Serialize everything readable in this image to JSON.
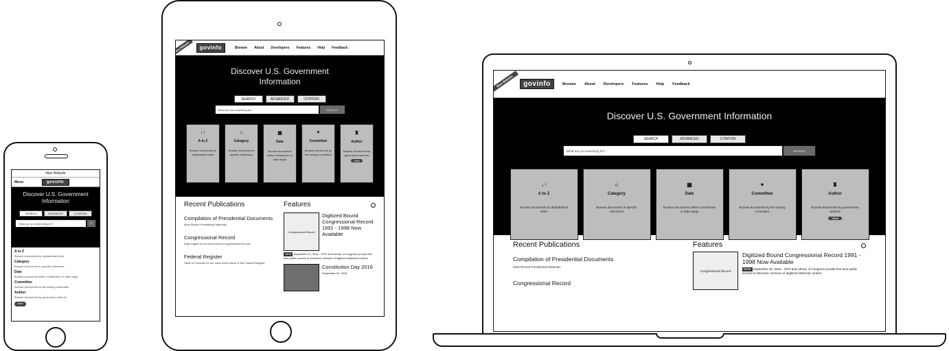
{
  "site": {
    "logo": "govinfo",
    "ribbon": "New Website",
    "nav": [
      "Browse",
      "About",
      "Developers",
      "Features",
      "Help",
      "Feedback"
    ],
    "menu_label": "Menu",
    "hero_title_line1": "Discover U.S. Government",
    "hero_title_line2": "Information",
    "hero_title_full": "Discover U.S. Government Information",
    "tabs": [
      "SEARCH",
      "ADVANCED",
      "CITATION"
    ],
    "search_placeholder": "What are you searching for?",
    "search_button": "SEARCH",
    "cards": [
      {
        "icon": "↓↑",
        "icon_name": "sort-az-icon",
        "title": "A to Z",
        "desc": "Browse documents by alphabetical order"
      },
      {
        "icon": "⌂",
        "icon_name": "category-icon",
        "title": "Category",
        "desc": "Browse documents in specific collections"
      },
      {
        "icon": "▦",
        "icon_name": "calendar-icon",
        "title": "Date",
        "desc": "Browse documents within a timeframe or date range"
      },
      {
        "icon": "♥",
        "icon_name": "committee-icon",
        "title": "Committee",
        "desc": "Browse documents by the issuing committee"
      },
      {
        "icon": "♜",
        "icon_name": "author-icon",
        "title": "Author",
        "desc": "Browse documents by government authors"
      }
    ],
    "recent_title": "Recent Publications",
    "features_title": "Features",
    "publications": [
      {
        "title": "Compilation of Presidential Documents",
        "sub": "Most Recent Presidential Materials"
      },
      {
        "title": "Congressional Record",
        "sub": "Daily Digest for the most recent Congressional Record"
      },
      {
        "title": "Federal Register",
        "sub": "Table of Contents for the most recent issue of the Federal Register"
      }
    ],
    "features": [
      {
        "thumb": "Congressional Record",
        "title": "Digitized Bound Congressional Record 1991 - 1998 Now Available",
        "tag": "NEW",
        "text": "September 20, 2016 - GPO and Library of Congress provide first time public access to electronic versions of digitized historical content"
      },
      {
        "thumb": "",
        "title": "Constitution Day 2016",
        "tag": "",
        "text": "September 16, 2016"
      }
    ],
    "pill": "View"
  }
}
